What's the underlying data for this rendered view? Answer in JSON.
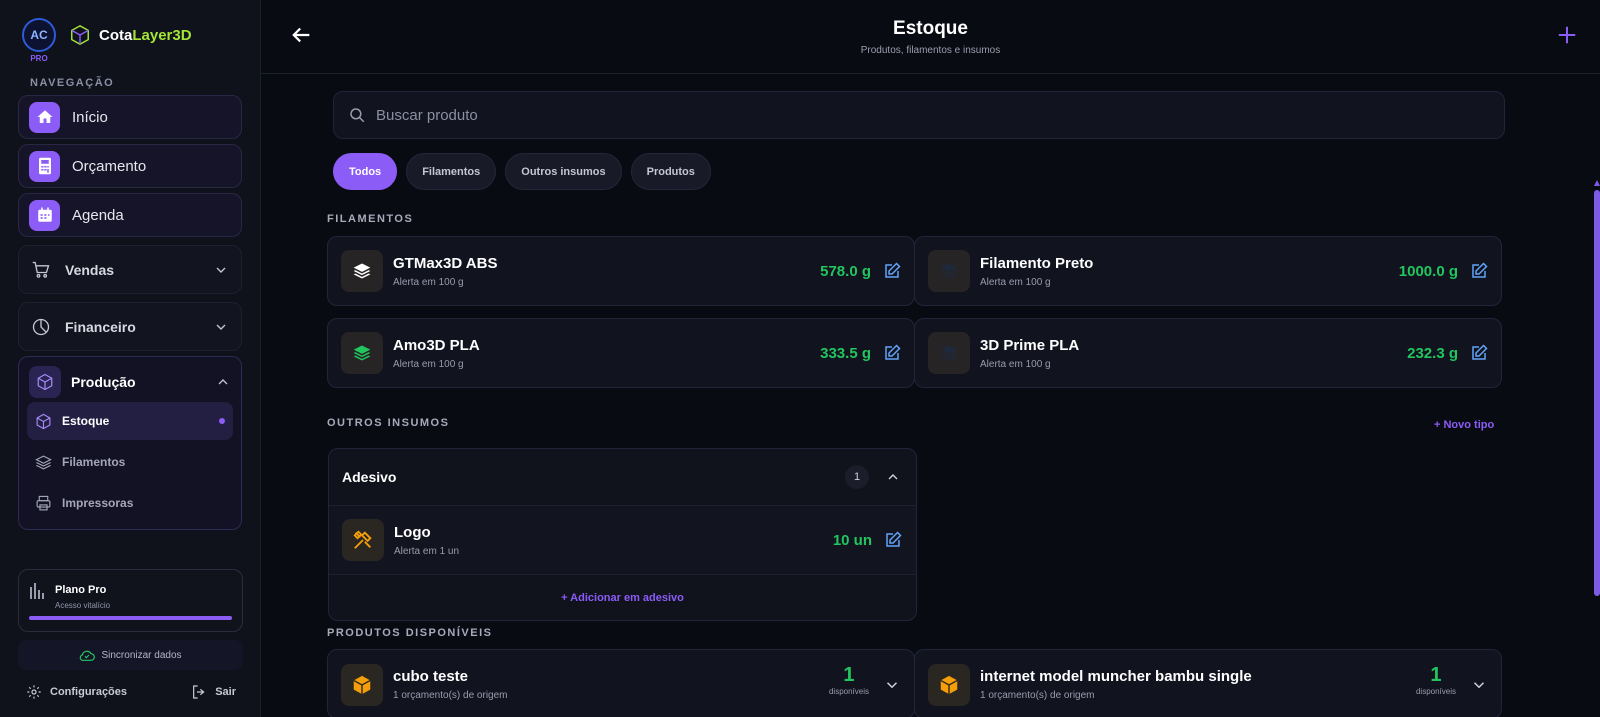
{
  "brand": {
    "avatar_initials": "AC",
    "avatar_badge": "PRO",
    "name_part1": "Cota",
    "name_part2": "Layer3D"
  },
  "sidebar": {
    "nav_title": "NAVEGAÇÃO",
    "items": [
      {
        "label": "Início",
        "icon": "home-icon"
      },
      {
        "label": "Orçamento",
        "icon": "calculator-icon"
      },
      {
        "label": "Agenda",
        "icon": "calendar-icon"
      }
    ],
    "groups": [
      {
        "label": "Vendas",
        "icon": "cart-icon"
      },
      {
        "label": "Financeiro",
        "icon": "pie-chart-icon"
      }
    ],
    "production": {
      "label": "Produção",
      "icon": "cube-icon",
      "subitems": [
        {
          "label": "Estoque",
          "icon": "cube-icon",
          "active": true
        },
        {
          "label": "Filamentos",
          "icon": "layers-icon"
        },
        {
          "label": "Impressoras",
          "icon": "printer-icon"
        }
      ]
    },
    "plan": {
      "title": "Plano Pro",
      "subtitle": "Acesso vitalício",
      "progress": 1.0
    },
    "sync_label": "Sincronizar dados",
    "settings_label": "Configurações",
    "logout_label": "Sair"
  },
  "header": {
    "title": "Estoque",
    "subtitle": "Produtos, filamentos e insumos"
  },
  "search": {
    "placeholder": "Buscar produto"
  },
  "filters": [
    "Todos",
    "Filamentos",
    "Outros insumos",
    "Produtos"
  ],
  "filamentos": {
    "title": "FILAMENTOS",
    "items": [
      {
        "name": "GTMax3D ABS",
        "alert": "Alerta em 100 g",
        "value": "578.0 g",
        "icon_color": "#ffffff"
      },
      {
        "name": "Filamento Preto",
        "alert": "Alerta em 100 g",
        "value": "1000.0 g",
        "icon_color": "#1e293b"
      },
      {
        "name": "Amo3D PLA",
        "alert": "Alerta em 100 g",
        "value": "333.5 g",
        "icon_color": "#22c55e"
      },
      {
        "name": "3D Prime PLA",
        "alert": "Alerta em 100 g",
        "value": "232.3 g",
        "icon_color": "#1e293b"
      }
    ]
  },
  "insumos": {
    "title": "OUTROS INSUMOS",
    "new_type": "+ Novo tipo",
    "group": {
      "name": "Adesivo",
      "count": "1",
      "item": {
        "name": "Logo",
        "alert": "Alerta em 1 un",
        "value": "10 un"
      },
      "add_label": "+ Adicionar em adesivo"
    }
  },
  "produtos": {
    "title": "PRODUTOS DISPONÍVEIS",
    "items": [
      {
        "name": "cubo teste",
        "origin": "1 orçamento(s) de origem",
        "count": "1",
        "count_label": "disponíveis"
      },
      {
        "name": "internet model muncher bambu single",
        "origin": "1 orçamento(s) de origem",
        "count": "1",
        "count_label": "disponíveis"
      }
    ]
  },
  "colors": {
    "accent": "#8b5cf6",
    "positive": "#22c55e",
    "background": "#090b12"
  }
}
